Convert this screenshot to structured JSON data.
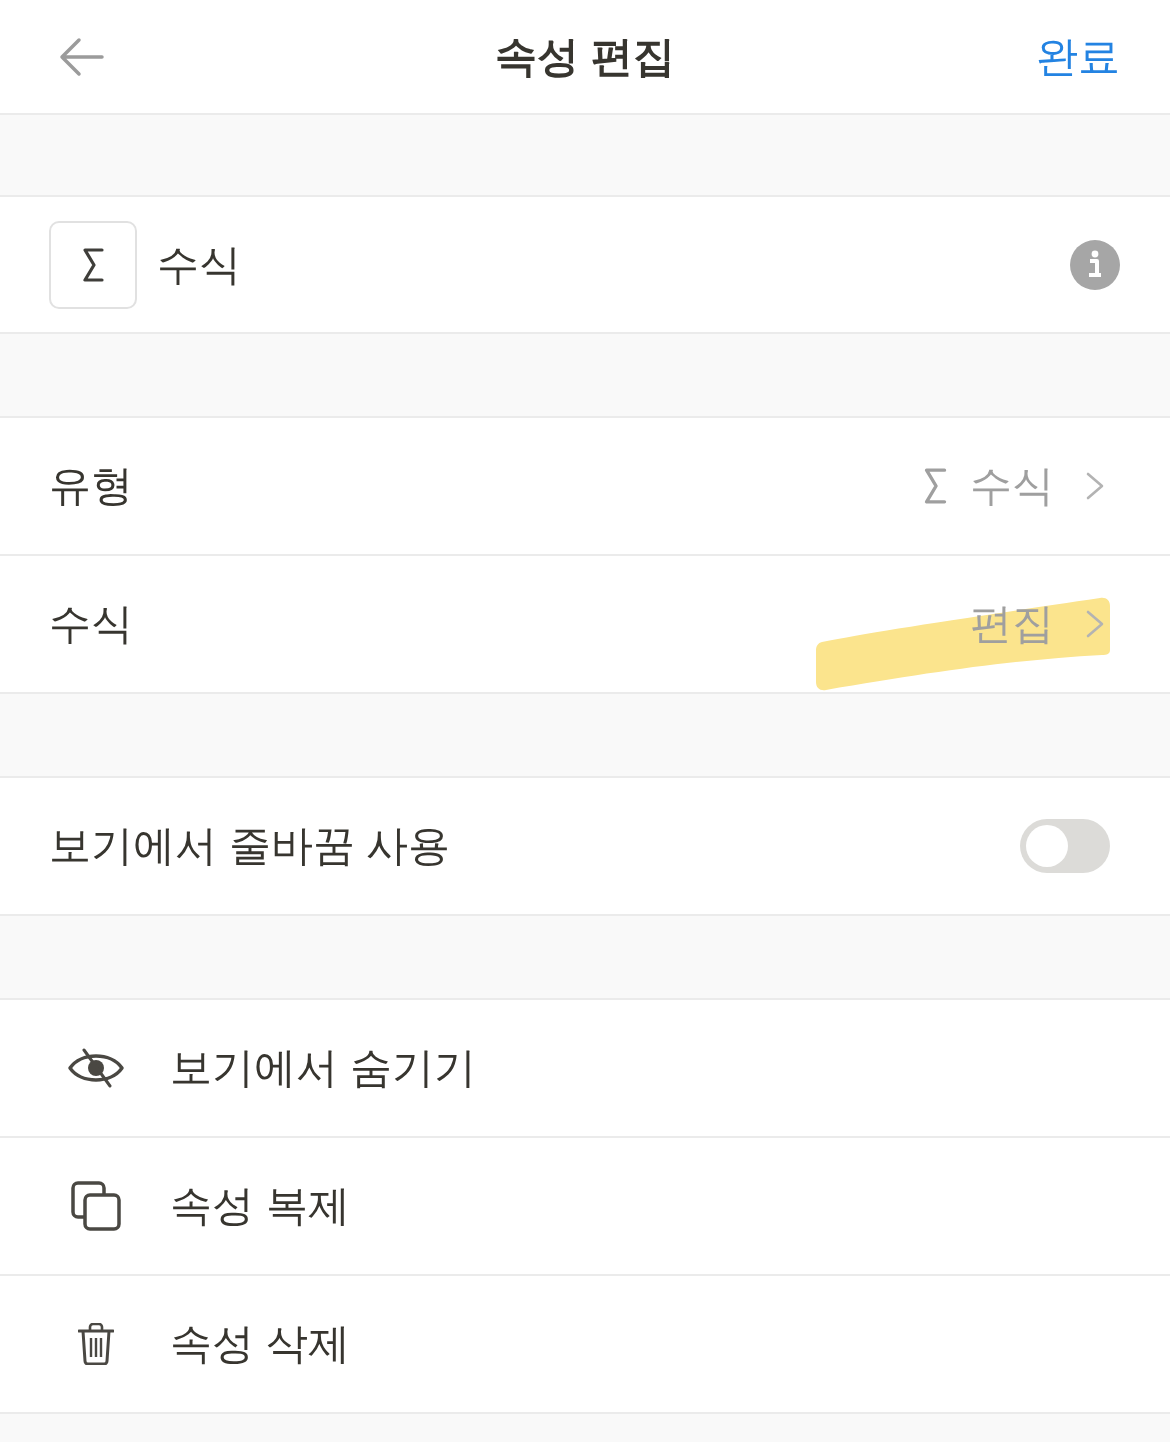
{
  "header": {
    "title": "속성 편집",
    "done_button": "완료"
  },
  "property": {
    "name": "수식"
  },
  "groups": [
    {
      "rows": [
        {
          "kind": "select",
          "label": "유형",
          "value": "수식",
          "highlighted": false
        },
        {
          "kind": "link",
          "label": "수식",
          "value": "편집",
          "highlighted": true
        }
      ]
    },
    {
      "rows": [
        {
          "kind": "toggle",
          "label": "보기에서 줄바꿈 사용",
          "on": false
        }
      ]
    },
    {
      "rows": [
        {
          "kind": "hide",
          "label": "보기에서 숨기기"
        },
        {
          "kind": "duplicate",
          "label": "속성 복제"
        },
        {
          "kind": "delete",
          "label": "속성 삭제"
        }
      ]
    }
  ]
}
